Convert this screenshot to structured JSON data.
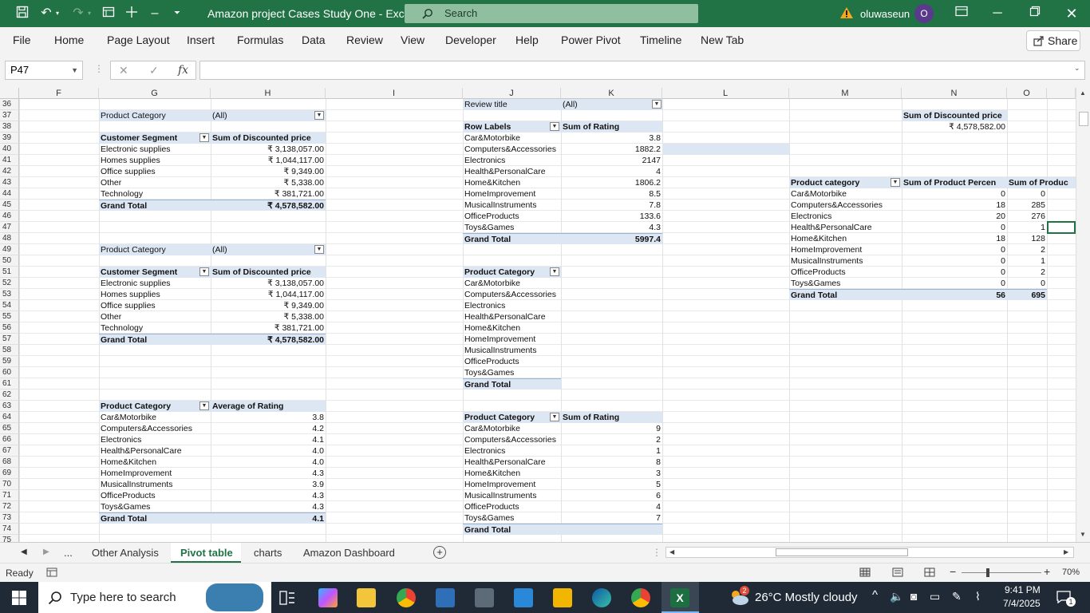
{
  "title_bar": {
    "file_title": "Amazon project Cases Study One  -  Excel",
    "search_label": "Search",
    "user_name": "oluwaseun",
    "avatar_initial": "O",
    "accent": "#217346"
  },
  "menu": {
    "items": [
      "File",
      "Home",
      "Page Layout",
      "Insert",
      "Formulas",
      "Data",
      "Review",
      "View",
      "Developer",
      "Help",
      "Power Pivot",
      "Timeline",
      "New Tab"
    ],
    "share": "Share"
  },
  "formula_bar": {
    "name_box": "P47",
    "fx": "fx",
    "formula": ""
  },
  "columns": [
    "F",
    "G",
    "H",
    "I",
    "J",
    "K",
    "L",
    "M",
    "N",
    "O"
  ],
  "rows": [
    "36",
    "37",
    "38",
    "39",
    "40",
    "41",
    "42",
    "43",
    "44",
    "45",
    "46",
    "47",
    "48",
    "49",
    "50",
    "51",
    "52",
    "53",
    "54",
    "55",
    "56",
    "57",
    "58",
    "59",
    "60",
    "61",
    "62",
    "63",
    "64",
    "65",
    "66",
    "67",
    "68",
    "69",
    "70",
    "71",
    "72",
    "73",
    "74",
    "75"
  ],
  "pivot1": {
    "filter_label": "Product Category",
    "filter_value": "(All)",
    "h1": "Customer Segment",
    "h2": "Sum of Discounted price",
    "rows": [
      [
        "Electronic supplies",
        "₹ 3,138,057.00"
      ],
      [
        "Homes supplies",
        "₹ 1,044,117.00"
      ],
      [
        "Office supplies",
        "₹ 9,349.00"
      ],
      [
        "Other",
        "₹ 5,338.00"
      ],
      [
        "Technology",
        "₹ 381,721.00"
      ]
    ],
    "total_label": "Grand Total",
    "total_value": "₹ 4,578,582.00"
  },
  "pivot2": {
    "filter_label": "Product Category",
    "filter_value": "(All)",
    "h1": "Customer Segment",
    "h2": "Sum of Discounted price",
    "rows": [
      [
        "Electronic supplies",
        "₹ 3,138,057.00"
      ],
      [
        "Homes supplies",
        "₹ 1,044,117.00"
      ],
      [
        "Office supplies",
        "₹ 9,349.00"
      ],
      [
        "Other",
        "₹ 5,338.00"
      ],
      [
        "Technology",
        "₹ 381,721.00"
      ]
    ],
    "total_label": "Grand Total",
    "total_value": "₹ 4,578,582.00"
  },
  "pivot3": {
    "h1": "Product Category",
    "h2": "Average of Rating",
    "rows": [
      [
        "Car&Motorbike",
        "3.8"
      ],
      [
        "Computers&Accessories",
        "4.2"
      ],
      [
        "Electronics",
        "4.1"
      ],
      [
        "Health&PersonalCare",
        "4.0"
      ],
      [
        "Home&Kitchen",
        "4.0"
      ],
      [
        "HomeImprovement",
        "4.3"
      ],
      [
        "MusicalInstruments",
        "3.9"
      ],
      [
        "OfficeProducts",
        "4.3"
      ],
      [
        "Toys&Games",
        "4.3"
      ]
    ],
    "total_label": "Grand Total",
    "total_value": "4.1"
  },
  "pivot4": {
    "filter_label": "Review title",
    "filter_value": "(All)",
    "h1": "Row Labels",
    "h2": "Sum of Rating",
    "rows": [
      [
        "Car&Motorbike",
        "3.8"
      ],
      [
        "Computers&Accessories",
        "1882.2"
      ],
      [
        "Electronics",
        "2147"
      ],
      [
        "Health&PersonalCare",
        "4"
      ],
      [
        "Home&Kitchen",
        "1806.2"
      ],
      [
        "HomeImprovement",
        "8.5"
      ],
      [
        "MusicalInstruments",
        "7.8"
      ],
      [
        "OfficeProducts",
        "133.6"
      ],
      [
        "Toys&Games",
        "4.3"
      ]
    ],
    "total_label": "Grand Total",
    "total_value": "5997.4"
  },
  "pivot5": {
    "h1": "Product Category",
    "rows": [
      "Car&Motorbike",
      "Computers&Accessories",
      "Electronics",
      "Health&PersonalCare",
      "Home&Kitchen",
      "HomeImprovement",
      "MusicalInstruments",
      "OfficeProducts",
      "Toys&Games"
    ],
    "total_label": "Grand Total"
  },
  "pivot6": {
    "h1": "Product Category",
    "h2": "Sum of Rating",
    "rows": [
      [
        "Car&Motorbike",
        "9"
      ],
      [
        "Computers&Accessories",
        "2"
      ],
      [
        "Electronics",
        "1"
      ],
      [
        "Health&PersonalCare",
        "8"
      ],
      [
        "Home&Kitchen",
        "3"
      ],
      [
        "HomeImprovement",
        "5"
      ],
      [
        "MusicalInstruments",
        "6"
      ],
      [
        "OfficeProducts",
        "4"
      ],
      [
        "Toys&Games",
        "7"
      ]
    ],
    "total_label": "Grand Total"
  },
  "pivot7": {
    "h1": "Sum of Discounted price",
    "value": "₹ 4,578,582.00"
  },
  "pivot8": {
    "h1": "Product category",
    "h2": "Sum of Product Percen",
    "h3": "Sum of Produc",
    "rows": [
      [
        "Car&Motorbike",
        "0",
        "0"
      ],
      [
        "Computers&Accessories",
        "18",
        "285"
      ],
      [
        "Electronics",
        "20",
        "276"
      ],
      [
        "Health&PersonalCare",
        "0",
        "1"
      ],
      [
        "Home&Kitchen",
        "18",
        "128"
      ],
      [
        "HomeImprovement",
        "0",
        "2"
      ],
      [
        "MusicalInstruments",
        "0",
        "1"
      ],
      [
        "OfficeProducts",
        "0",
        "2"
      ],
      [
        "Toys&Games",
        "0",
        "0"
      ]
    ],
    "total_label": "Grand Total",
    "total1": "56",
    "total2": "695"
  },
  "sheet_tabs": {
    "ellipsis": "...",
    "tabs": [
      "Other Analysis",
      "Pivot table",
      "charts",
      "Amazon Dashboard"
    ],
    "active": "Pivot table"
  },
  "status": {
    "ready": "Ready",
    "zoom": "70%"
  },
  "taskbar": {
    "search_placeholder": "Type here to search",
    "weather": "26°C  Mostly cloudy",
    "weather_badge": "2",
    "time": "9:41 PM",
    "date": "7/4/2025",
    "notif_count": "1"
  }
}
